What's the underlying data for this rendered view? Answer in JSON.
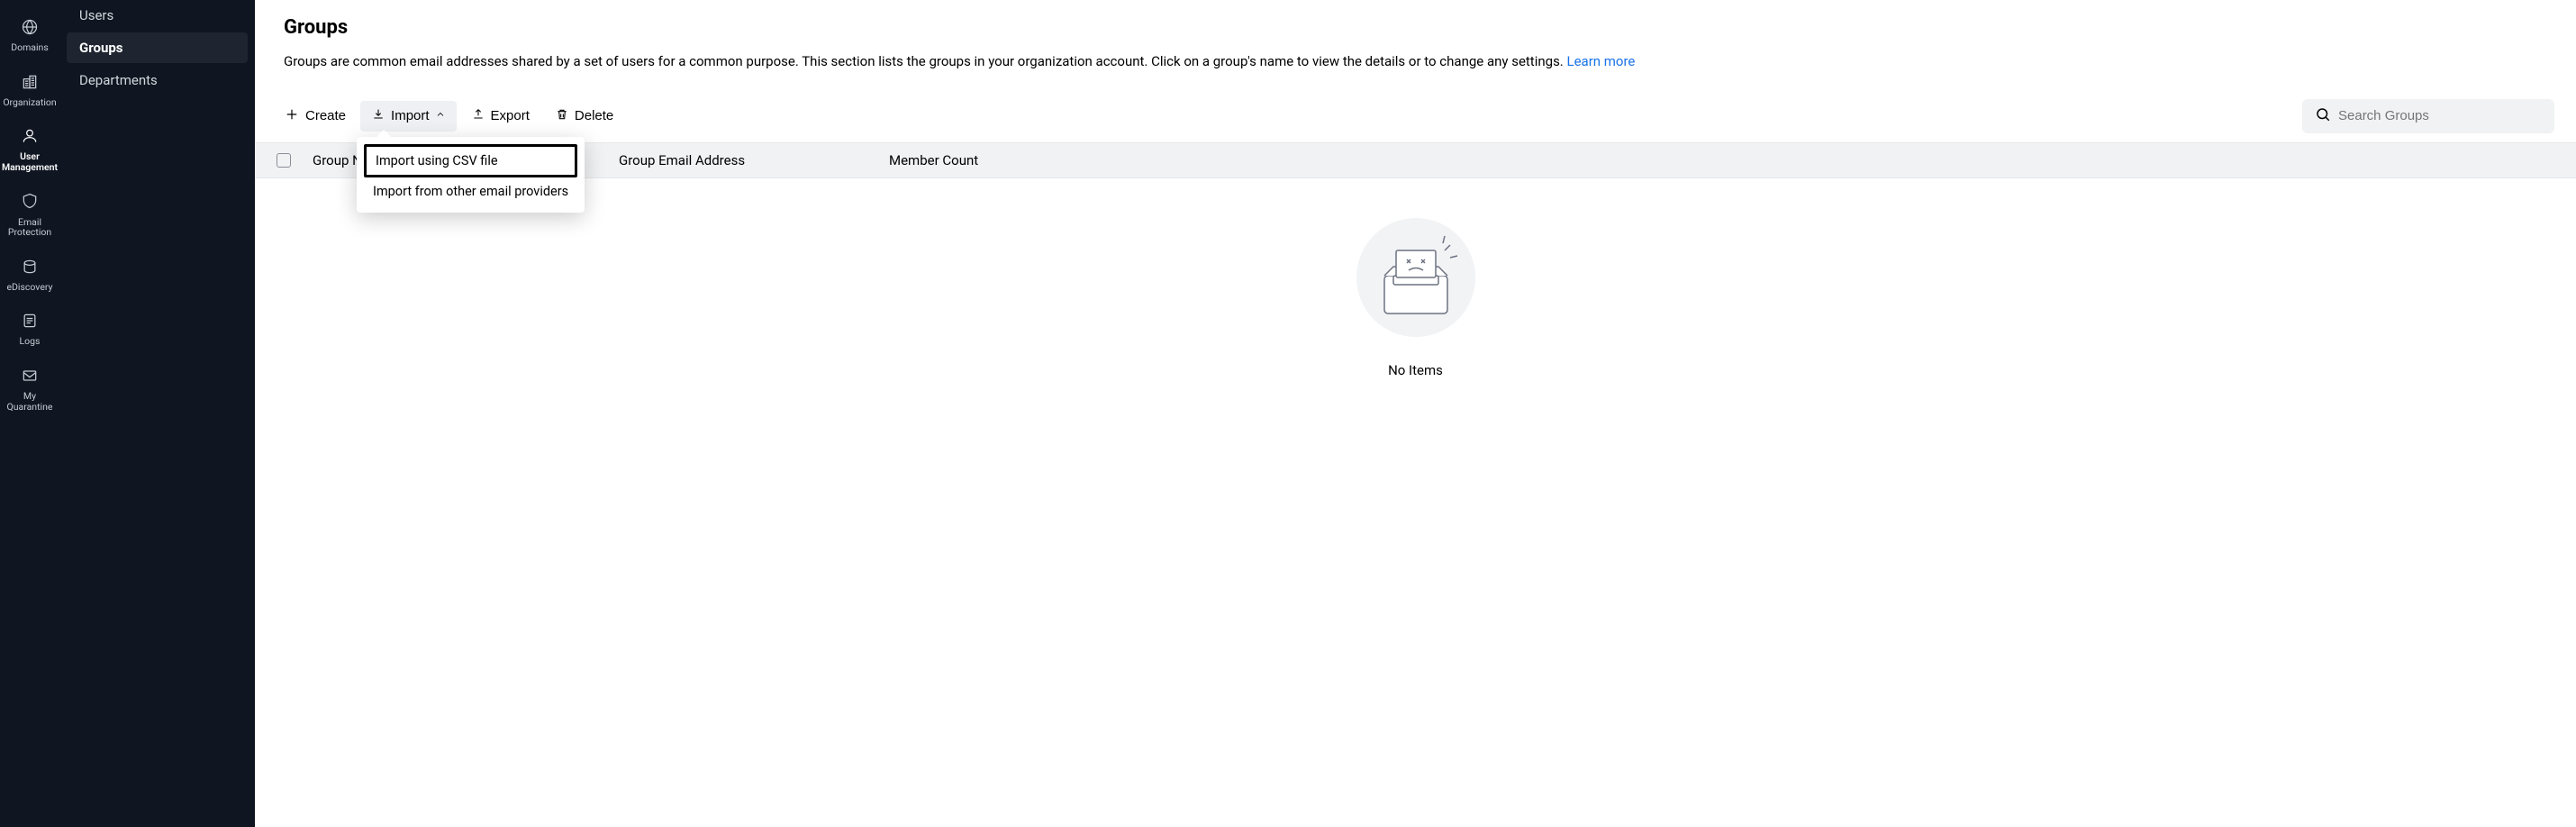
{
  "rail": {
    "items": [
      {
        "id": "domains",
        "label": "Domains"
      },
      {
        "id": "organization",
        "label": "Organization"
      },
      {
        "id": "user-management",
        "label": "User\nManagement"
      },
      {
        "id": "email-protection",
        "label": "Email\nProtection"
      },
      {
        "id": "ediscovery",
        "label": "eDiscovery"
      },
      {
        "id": "logs",
        "label": "Logs"
      },
      {
        "id": "my-quarantine",
        "label": "My\nQuarantine"
      }
    ],
    "active": "user-management"
  },
  "sub_sidebar": {
    "items": [
      {
        "id": "users",
        "label": "Users"
      },
      {
        "id": "groups",
        "label": "Groups"
      },
      {
        "id": "departments",
        "label": "Departments"
      }
    ],
    "active": "groups"
  },
  "page": {
    "title": "Groups",
    "description": "Groups are common email addresses shared by a set of users for a common purpose. This section lists the groups in your organization account. Click on a group's name to view the details or to change any settings. ",
    "learn_more": "Learn more"
  },
  "toolbar": {
    "create": "Create",
    "import": "Import",
    "export": "Export",
    "delete": "Delete",
    "search_placeholder": "Search Groups"
  },
  "import_dropdown": {
    "csv": "Import using CSV file",
    "other": "Import from other email providers"
  },
  "table": {
    "col_name": "Group Name",
    "col_email": "Group Email Address",
    "col_count": "Member Count"
  },
  "empty": {
    "text": "No Items"
  }
}
